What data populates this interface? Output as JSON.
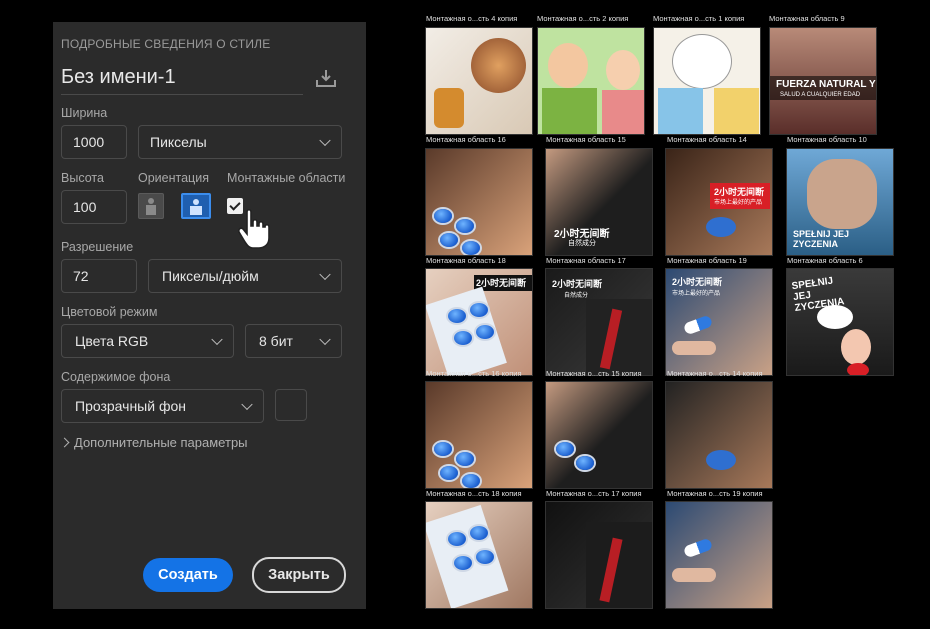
{
  "panel": {
    "section_title": "ПОДРОБНЫЕ СВЕДЕНИЯ О СТИЛЕ",
    "doc_name": "Без имени-1",
    "width_label": "Ширина",
    "width_value": "1000",
    "width_unit": "Пикселы",
    "height_label": "Высота",
    "height_value": "100",
    "orientation_label": "Ориентация",
    "artboards_label": "Монтажные области",
    "artboards_checked": true,
    "resolution_label": "Разрешение",
    "resolution_value": "72",
    "resolution_unit": "Пикселы/дюйм",
    "color_mode_label": "Цветовой режим",
    "color_mode_value": "Цвета RGB",
    "bit_depth_value": "8 бит",
    "background_label": "Содержимое фона",
    "background_value": "Прозрачный фон",
    "advanced_label": "Дополнительные параметры",
    "create_button": "Создать",
    "close_button": "Закрыть"
  },
  "artboards": [
    {
      "label": "Монтажная о...сть 4 копия",
      "scene": "illustration-medical",
      "caption": ""
    },
    {
      "label": "Монтажная о...сть 2 копия",
      "scene": "illustration-couple",
      "caption": ""
    },
    {
      "label": "Монтажная о...сть 1 копия",
      "scene": "illustration-couple-2",
      "caption": ""
    },
    {
      "label": "Монтажная область 9",
      "scene": "couple-banner",
      "caption": "FUERZA NATURAL Y",
      "subcaption": "SALUD A CUALQUIER EDAD"
    },
    {
      "label": "Монтажная область 16",
      "scene": "couple-pills",
      "caption": ""
    },
    {
      "label": "Монтажная область 15",
      "scene": "couple-dark",
      "caption": "2小时无间断",
      "subcaption": "自然成分"
    },
    {
      "label": "Монтажная область 14",
      "scene": "red-banner",
      "caption": "2小时无间断",
      "subcaption": "市场上最好的产品"
    },
    {
      "label": "Монтажная область 10",
      "scene": "hug",
      "caption": "SPEŁNIJ JEJ ZYCZENIA"
    },
    {
      "label": "Монтажная область 18",
      "scene": "pills-hand",
      "caption": "2小时无间断"
    },
    {
      "label": "Монтажная область 17",
      "scene": "tie-dark",
      "caption": "2小时无间断",
      "subcaption": "自然成分"
    },
    {
      "label": "Монтажная область 19",
      "scene": "pill-float",
      "caption": "2小时无间断",
      "subcaption": "市场上最好的产品"
    },
    {
      "label": "Монтажная область 6",
      "scene": "poster",
      "caption": "SPEŁNIJ JEJ ZYCZENIA"
    },
    {
      "label": "Монтажная о...сть 16 копия",
      "scene": "couple-pills",
      "caption": ""
    },
    {
      "label": "Монтажная о...сть 15 копия",
      "scene": "couple-dark",
      "caption": ""
    },
    {
      "label": "Монтажная о...сть 14 копия",
      "scene": "red-banner",
      "caption": ""
    },
    {
      "label": "Монтажная о...сть 18 копия",
      "scene": "pills-hand",
      "caption": ""
    },
    {
      "label": "Монтажная о...сть 17 копия",
      "scene": "tie-dark",
      "caption": ""
    },
    {
      "label": "Монтажная о...сть 19 копия",
      "scene": "pill-float",
      "caption": ""
    }
  ],
  "colors": {
    "panel_bg": "#2b2b2b",
    "accent": "#1473e6",
    "page_bg": "#000000"
  }
}
